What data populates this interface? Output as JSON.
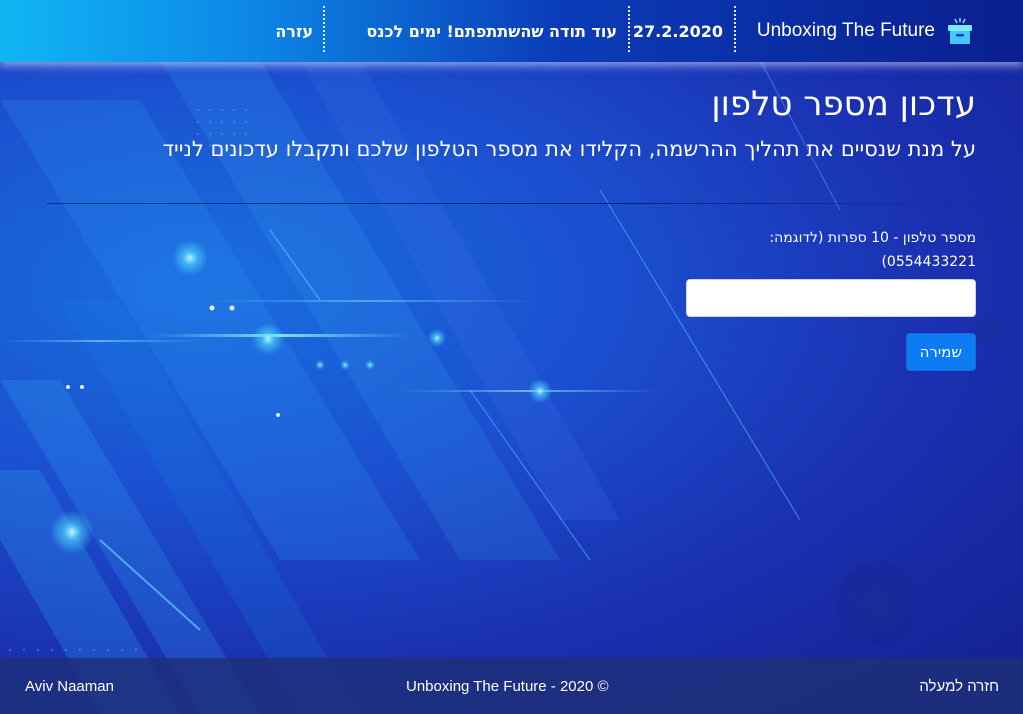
{
  "header": {
    "brand_name": "Unboxing The Future",
    "brand_icon": "open-box-icon",
    "date": "27.2.2020",
    "days_text": "עוד תודה שהשתתפתם! ימים לכנס",
    "help_link": "עזרה"
  },
  "main": {
    "title": "עדכון מספר טלפון",
    "subtitle": "על מנת שנסיים את תהליך ההרשמה, הקלידו את מספר הטלפון שלכם ותקבלו עדכונים לנייד",
    "phone_label": "מספר טלפון - 10 ספרות (לדוגמה: 0554433221)",
    "phone_value": "",
    "save_label": "שמירה"
  },
  "footer": {
    "author": "Aviv Naaman",
    "copyright": "Unboxing The Future - 2020 ©",
    "back_to_top": "חזרה למעלה"
  },
  "colors": {
    "header_gradient_start": "#10b6f4",
    "header_gradient_end": "#0a1f8f",
    "background": "#1a3fc0",
    "primary_button": "#0d7cf2",
    "footer": "#1e3078"
  }
}
